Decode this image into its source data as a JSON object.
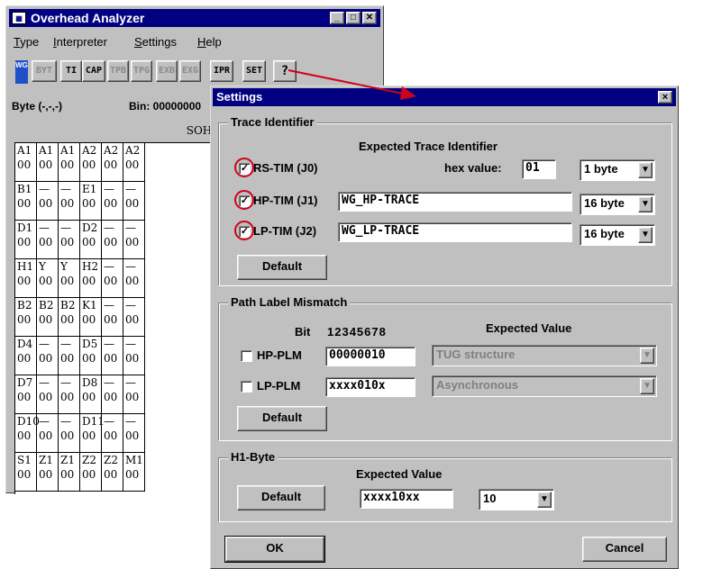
{
  "main_window": {
    "title": "Overhead Analyzer",
    "menu": [
      {
        "label": "Type",
        "access": "T"
      },
      {
        "label": "Interpreter",
        "access": "I"
      },
      {
        "label": "Settings",
        "access": "S"
      },
      {
        "label": "Help",
        "access": "H"
      }
    ],
    "toolbar": {
      "logo": "WG",
      "buttons": [
        {
          "label": "BYT",
          "enabled": false
        },
        {
          "label": "TI",
          "enabled": true
        },
        {
          "label": "CAP",
          "enabled": true
        },
        {
          "label": "TPB",
          "enabled": false
        },
        {
          "label": "TPG",
          "enabled": false
        },
        {
          "label": "EXB",
          "enabled": false
        },
        {
          "label": "EXG",
          "enabled": false
        },
        {
          "label": "IPR",
          "enabled": true
        },
        {
          "label": "SET",
          "enabled": true
        },
        {
          "label": "?",
          "enabled": true
        }
      ]
    },
    "byte_label": "Byte (-,-,-)",
    "bin_label": "Bin: 00000000",
    "section_header": "SOH",
    "grid_rows": [
      [
        [
          "A1",
          "00"
        ],
        [
          "A1",
          "00"
        ],
        [
          "A1",
          "00"
        ],
        [
          "A2",
          "00"
        ],
        [
          "A2",
          "00"
        ],
        [
          "A2",
          "00"
        ]
      ],
      [
        [
          "B1",
          "00"
        ],
        [
          "—",
          "00"
        ],
        [
          "—",
          "00"
        ],
        [
          "E1",
          "00"
        ],
        [
          "—",
          "00"
        ],
        [
          "—",
          "00"
        ]
      ],
      [
        [
          "D1",
          "00"
        ],
        [
          "—",
          "00"
        ],
        [
          "—",
          "00"
        ],
        [
          "D2",
          "00"
        ],
        [
          "—",
          "00"
        ],
        [
          "—",
          "00"
        ]
      ],
      [
        [
          "H1",
          "00"
        ],
        [
          "Y",
          "00"
        ],
        [
          "Y",
          "00"
        ],
        [
          "H2",
          "00"
        ],
        [
          "—",
          "00"
        ],
        [
          "—",
          "00"
        ]
      ],
      [
        [
          "B2",
          "00"
        ],
        [
          "B2",
          "00"
        ],
        [
          "B2",
          "00"
        ],
        [
          "K1",
          "00"
        ],
        [
          "—",
          "00"
        ],
        [
          "—",
          "00"
        ]
      ],
      [
        [
          "D4",
          "00"
        ],
        [
          "—",
          "00"
        ],
        [
          "—",
          "00"
        ],
        [
          "D5",
          "00"
        ],
        [
          "—",
          "00"
        ],
        [
          "—",
          "00"
        ]
      ],
      [
        [
          "D7",
          "00"
        ],
        [
          "—",
          "00"
        ],
        [
          "—",
          "00"
        ],
        [
          "D8",
          "00"
        ],
        [
          "—",
          "00"
        ],
        [
          "—",
          "00"
        ]
      ],
      [
        [
          "D10",
          "00"
        ],
        [
          "—",
          "00"
        ],
        [
          "—",
          "00"
        ],
        [
          "D11",
          "00"
        ],
        [
          "—",
          "00"
        ],
        [
          "—",
          "00"
        ]
      ],
      [
        [
          "S1",
          "00"
        ],
        [
          "Z1",
          "00"
        ],
        [
          "Z1",
          "00"
        ],
        [
          "Z2",
          "00"
        ],
        [
          "Z2",
          "00"
        ],
        [
          "M1",
          "00"
        ]
      ]
    ]
  },
  "settings": {
    "title": "Settings",
    "close": "×",
    "trace": {
      "group": "Trace Identifier",
      "expected_header": "Expected Trace Identifier",
      "hex_label": "hex value:",
      "rows": [
        {
          "label": "RS-TIM (J0)",
          "checked": true,
          "value": "01",
          "length": "1 byte"
        },
        {
          "label": "HP-TIM (J1)",
          "checked": true,
          "value": "WG_HP-TRACE",
          "length": "16 byte"
        },
        {
          "label": "LP-TIM (J2)",
          "checked": true,
          "value": "WG_LP-TRACE",
          "length": "16 byte"
        }
      ],
      "default_button": "Default"
    },
    "plm": {
      "group": "Path Label Mismatch",
      "bit_label": "Bit",
      "bit_numbers": "12345678",
      "expected_header": "Expected Value",
      "rows": [
        {
          "label": "HP-PLM",
          "checked": false,
          "bits": "00000010",
          "value": "TUG structure"
        },
        {
          "label": "LP-PLM",
          "checked": false,
          "bits": "xxxx010x",
          "value": "Asynchronous"
        }
      ],
      "default_button": "Default"
    },
    "h1": {
      "group": "H1-Byte",
      "expected_header": "Expected Value",
      "default_button": "Default",
      "pattern": "xxxx10xx",
      "value": "10"
    },
    "ok": "OK",
    "cancel": "Cancel"
  },
  "annotation_color": "#d0021b"
}
